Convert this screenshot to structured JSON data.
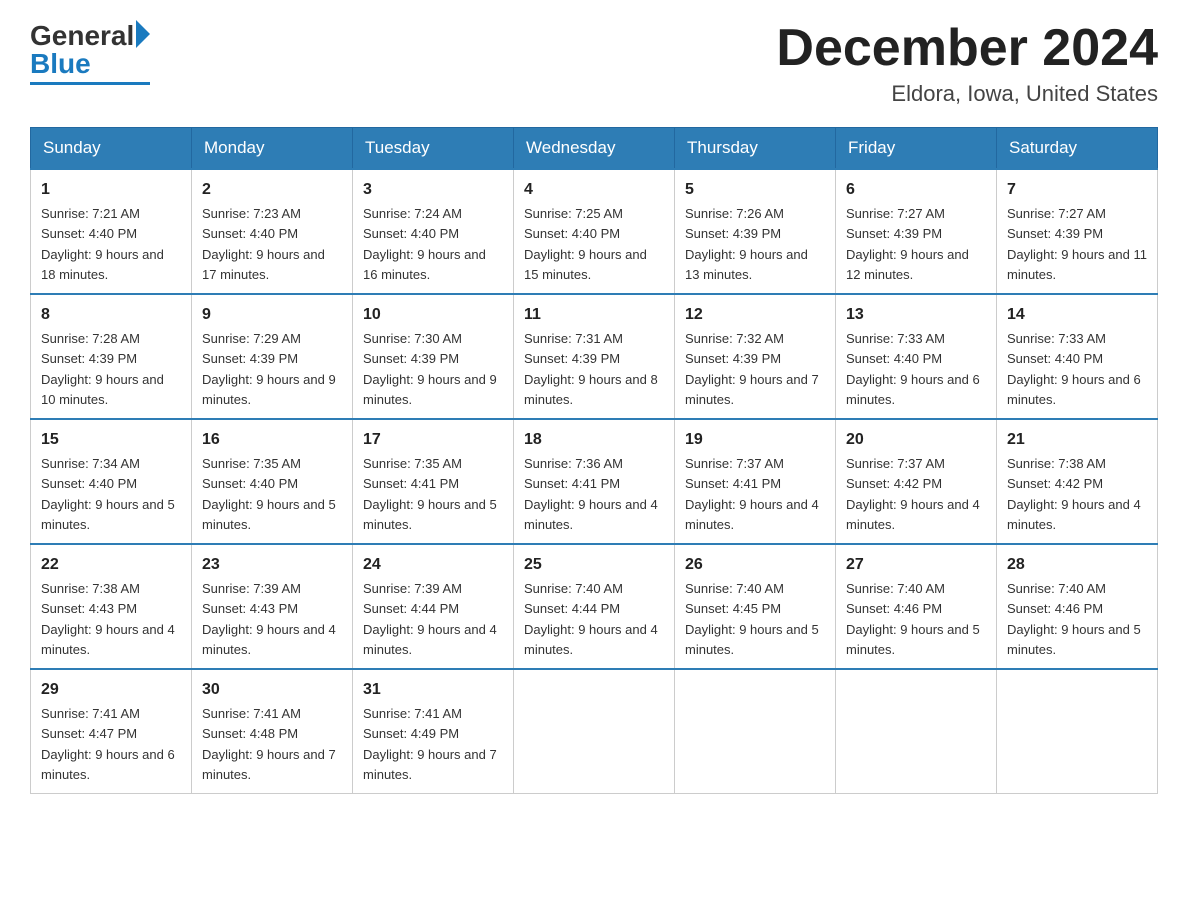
{
  "header": {
    "logo_general": "General",
    "logo_blue": "Blue",
    "month_title": "December 2024",
    "location": "Eldora, Iowa, United States"
  },
  "days_of_week": [
    "Sunday",
    "Monday",
    "Tuesday",
    "Wednesday",
    "Thursday",
    "Friday",
    "Saturday"
  ],
  "weeks": [
    [
      {
        "day": "1",
        "sunrise": "7:21 AM",
        "sunset": "4:40 PM",
        "daylight": "9 hours and 18 minutes."
      },
      {
        "day": "2",
        "sunrise": "7:23 AM",
        "sunset": "4:40 PM",
        "daylight": "9 hours and 17 minutes."
      },
      {
        "day": "3",
        "sunrise": "7:24 AM",
        "sunset": "4:40 PM",
        "daylight": "9 hours and 16 minutes."
      },
      {
        "day": "4",
        "sunrise": "7:25 AM",
        "sunset": "4:40 PM",
        "daylight": "9 hours and 15 minutes."
      },
      {
        "day": "5",
        "sunrise": "7:26 AM",
        "sunset": "4:39 PM",
        "daylight": "9 hours and 13 minutes."
      },
      {
        "day": "6",
        "sunrise": "7:27 AM",
        "sunset": "4:39 PM",
        "daylight": "9 hours and 12 minutes."
      },
      {
        "day": "7",
        "sunrise": "7:27 AM",
        "sunset": "4:39 PM",
        "daylight": "9 hours and 11 minutes."
      }
    ],
    [
      {
        "day": "8",
        "sunrise": "7:28 AM",
        "sunset": "4:39 PM",
        "daylight": "9 hours and 10 minutes."
      },
      {
        "day": "9",
        "sunrise": "7:29 AM",
        "sunset": "4:39 PM",
        "daylight": "9 hours and 9 minutes."
      },
      {
        "day": "10",
        "sunrise": "7:30 AM",
        "sunset": "4:39 PM",
        "daylight": "9 hours and 9 minutes."
      },
      {
        "day": "11",
        "sunrise": "7:31 AM",
        "sunset": "4:39 PM",
        "daylight": "9 hours and 8 minutes."
      },
      {
        "day": "12",
        "sunrise": "7:32 AM",
        "sunset": "4:39 PM",
        "daylight": "9 hours and 7 minutes."
      },
      {
        "day": "13",
        "sunrise": "7:33 AM",
        "sunset": "4:40 PM",
        "daylight": "9 hours and 6 minutes."
      },
      {
        "day": "14",
        "sunrise": "7:33 AM",
        "sunset": "4:40 PM",
        "daylight": "9 hours and 6 minutes."
      }
    ],
    [
      {
        "day": "15",
        "sunrise": "7:34 AM",
        "sunset": "4:40 PM",
        "daylight": "9 hours and 5 minutes."
      },
      {
        "day": "16",
        "sunrise": "7:35 AM",
        "sunset": "4:40 PM",
        "daylight": "9 hours and 5 minutes."
      },
      {
        "day": "17",
        "sunrise": "7:35 AM",
        "sunset": "4:41 PM",
        "daylight": "9 hours and 5 minutes."
      },
      {
        "day": "18",
        "sunrise": "7:36 AM",
        "sunset": "4:41 PM",
        "daylight": "9 hours and 4 minutes."
      },
      {
        "day": "19",
        "sunrise": "7:37 AM",
        "sunset": "4:41 PM",
        "daylight": "9 hours and 4 minutes."
      },
      {
        "day": "20",
        "sunrise": "7:37 AM",
        "sunset": "4:42 PM",
        "daylight": "9 hours and 4 minutes."
      },
      {
        "day": "21",
        "sunrise": "7:38 AM",
        "sunset": "4:42 PM",
        "daylight": "9 hours and 4 minutes."
      }
    ],
    [
      {
        "day": "22",
        "sunrise": "7:38 AM",
        "sunset": "4:43 PM",
        "daylight": "9 hours and 4 minutes."
      },
      {
        "day": "23",
        "sunrise": "7:39 AM",
        "sunset": "4:43 PM",
        "daylight": "9 hours and 4 minutes."
      },
      {
        "day": "24",
        "sunrise": "7:39 AM",
        "sunset": "4:44 PM",
        "daylight": "9 hours and 4 minutes."
      },
      {
        "day": "25",
        "sunrise": "7:40 AM",
        "sunset": "4:44 PM",
        "daylight": "9 hours and 4 minutes."
      },
      {
        "day": "26",
        "sunrise": "7:40 AM",
        "sunset": "4:45 PM",
        "daylight": "9 hours and 5 minutes."
      },
      {
        "day": "27",
        "sunrise": "7:40 AM",
        "sunset": "4:46 PM",
        "daylight": "9 hours and 5 minutes."
      },
      {
        "day": "28",
        "sunrise": "7:40 AM",
        "sunset": "4:46 PM",
        "daylight": "9 hours and 5 minutes."
      }
    ],
    [
      {
        "day": "29",
        "sunrise": "7:41 AM",
        "sunset": "4:47 PM",
        "daylight": "9 hours and 6 minutes."
      },
      {
        "day": "30",
        "sunrise": "7:41 AM",
        "sunset": "4:48 PM",
        "daylight": "9 hours and 7 minutes."
      },
      {
        "day": "31",
        "sunrise": "7:41 AM",
        "sunset": "4:49 PM",
        "daylight": "9 hours and 7 minutes."
      },
      null,
      null,
      null,
      null
    ]
  ]
}
